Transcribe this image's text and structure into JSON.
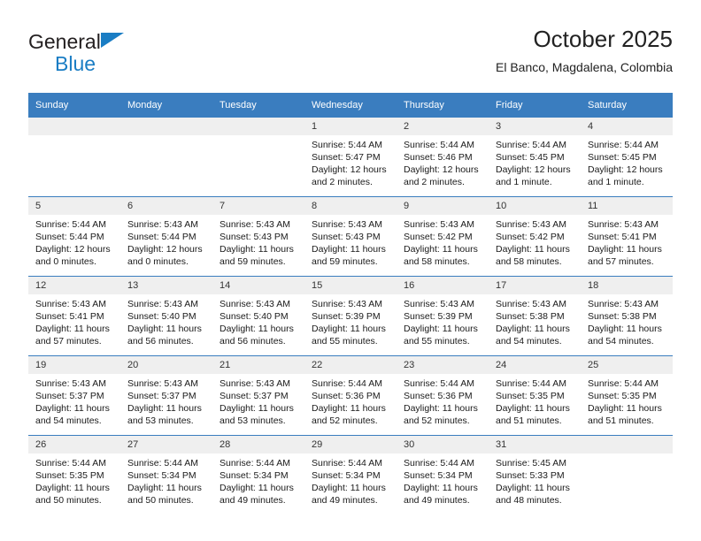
{
  "brand": {
    "name_part1": "General",
    "name_part2": "Blue",
    "triangle_color": "#1a7dc4"
  },
  "header": {
    "title": "October 2025",
    "subtitle": "El Banco, Magdalena, Colombia"
  },
  "theme": {
    "header_bg": "#3a7dbf",
    "daynum_bg": "#efefef",
    "text": "#1a1a1a"
  },
  "weekdays": [
    "Sunday",
    "Monday",
    "Tuesday",
    "Wednesday",
    "Thursday",
    "Friday",
    "Saturday"
  ],
  "weeks": [
    [
      {
        "day": "",
        "empty": true
      },
      {
        "day": "",
        "empty": true
      },
      {
        "day": "",
        "empty": true
      },
      {
        "day": "1",
        "sunrise": "Sunrise: 5:44 AM",
        "sunset": "Sunset: 5:47 PM",
        "daylight1": "Daylight: 12 hours",
        "daylight2": "and 2 minutes."
      },
      {
        "day": "2",
        "sunrise": "Sunrise: 5:44 AM",
        "sunset": "Sunset: 5:46 PM",
        "daylight1": "Daylight: 12 hours",
        "daylight2": "and 2 minutes."
      },
      {
        "day": "3",
        "sunrise": "Sunrise: 5:44 AM",
        "sunset": "Sunset: 5:45 PM",
        "daylight1": "Daylight: 12 hours",
        "daylight2": "and 1 minute."
      },
      {
        "day": "4",
        "sunrise": "Sunrise: 5:44 AM",
        "sunset": "Sunset: 5:45 PM",
        "daylight1": "Daylight: 12 hours",
        "daylight2": "and 1 minute."
      }
    ],
    [
      {
        "day": "5",
        "sunrise": "Sunrise: 5:44 AM",
        "sunset": "Sunset: 5:44 PM",
        "daylight1": "Daylight: 12 hours",
        "daylight2": "and 0 minutes."
      },
      {
        "day": "6",
        "sunrise": "Sunrise: 5:43 AM",
        "sunset": "Sunset: 5:44 PM",
        "daylight1": "Daylight: 12 hours",
        "daylight2": "and 0 minutes."
      },
      {
        "day": "7",
        "sunrise": "Sunrise: 5:43 AM",
        "sunset": "Sunset: 5:43 PM",
        "daylight1": "Daylight: 11 hours",
        "daylight2": "and 59 minutes."
      },
      {
        "day": "8",
        "sunrise": "Sunrise: 5:43 AM",
        "sunset": "Sunset: 5:43 PM",
        "daylight1": "Daylight: 11 hours",
        "daylight2": "and 59 minutes."
      },
      {
        "day": "9",
        "sunrise": "Sunrise: 5:43 AM",
        "sunset": "Sunset: 5:42 PM",
        "daylight1": "Daylight: 11 hours",
        "daylight2": "and 58 minutes."
      },
      {
        "day": "10",
        "sunrise": "Sunrise: 5:43 AM",
        "sunset": "Sunset: 5:42 PM",
        "daylight1": "Daylight: 11 hours",
        "daylight2": "and 58 minutes."
      },
      {
        "day": "11",
        "sunrise": "Sunrise: 5:43 AM",
        "sunset": "Sunset: 5:41 PM",
        "daylight1": "Daylight: 11 hours",
        "daylight2": "and 57 minutes."
      }
    ],
    [
      {
        "day": "12",
        "sunrise": "Sunrise: 5:43 AM",
        "sunset": "Sunset: 5:41 PM",
        "daylight1": "Daylight: 11 hours",
        "daylight2": "and 57 minutes."
      },
      {
        "day": "13",
        "sunrise": "Sunrise: 5:43 AM",
        "sunset": "Sunset: 5:40 PM",
        "daylight1": "Daylight: 11 hours",
        "daylight2": "and 56 minutes."
      },
      {
        "day": "14",
        "sunrise": "Sunrise: 5:43 AM",
        "sunset": "Sunset: 5:40 PM",
        "daylight1": "Daylight: 11 hours",
        "daylight2": "and 56 minutes."
      },
      {
        "day": "15",
        "sunrise": "Sunrise: 5:43 AM",
        "sunset": "Sunset: 5:39 PM",
        "daylight1": "Daylight: 11 hours",
        "daylight2": "and 55 minutes."
      },
      {
        "day": "16",
        "sunrise": "Sunrise: 5:43 AM",
        "sunset": "Sunset: 5:39 PM",
        "daylight1": "Daylight: 11 hours",
        "daylight2": "and 55 minutes."
      },
      {
        "day": "17",
        "sunrise": "Sunrise: 5:43 AM",
        "sunset": "Sunset: 5:38 PM",
        "daylight1": "Daylight: 11 hours",
        "daylight2": "and 54 minutes."
      },
      {
        "day": "18",
        "sunrise": "Sunrise: 5:43 AM",
        "sunset": "Sunset: 5:38 PM",
        "daylight1": "Daylight: 11 hours",
        "daylight2": "and 54 minutes."
      }
    ],
    [
      {
        "day": "19",
        "sunrise": "Sunrise: 5:43 AM",
        "sunset": "Sunset: 5:37 PM",
        "daylight1": "Daylight: 11 hours",
        "daylight2": "and 54 minutes."
      },
      {
        "day": "20",
        "sunrise": "Sunrise: 5:43 AM",
        "sunset": "Sunset: 5:37 PM",
        "daylight1": "Daylight: 11 hours",
        "daylight2": "and 53 minutes."
      },
      {
        "day": "21",
        "sunrise": "Sunrise: 5:43 AM",
        "sunset": "Sunset: 5:37 PM",
        "daylight1": "Daylight: 11 hours",
        "daylight2": "and 53 minutes."
      },
      {
        "day": "22",
        "sunrise": "Sunrise: 5:44 AM",
        "sunset": "Sunset: 5:36 PM",
        "daylight1": "Daylight: 11 hours",
        "daylight2": "and 52 minutes."
      },
      {
        "day": "23",
        "sunrise": "Sunrise: 5:44 AM",
        "sunset": "Sunset: 5:36 PM",
        "daylight1": "Daylight: 11 hours",
        "daylight2": "and 52 minutes."
      },
      {
        "day": "24",
        "sunrise": "Sunrise: 5:44 AM",
        "sunset": "Sunset: 5:35 PM",
        "daylight1": "Daylight: 11 hours",
        "daylight2": "and 51 minutes."
      },
      {
        "day": "25",
        "sunrise": "Sunrise: 5:44 AM",
        "sunset": "Sunset: 5:35 PM",
        "daylight1": "Daylight: 11 hours",
        "daylight2": "and 51 minutes."
      }
    ],
    [
      {
        "day": "26",
        "sunrise": "Sunrise: 5:44 AM",
        "sunset": "Sunset: 5:35 PM",
        "daylight1": "Daylight: 11 hours",
        "daylight2": "and 50 minutes."
      },
      {
        "day": "27",
        "sunrise": "Sunrise: 5:44 AM",
        "sunset": "Sunset: 5:34 PM",
        "daylight1": "Daylight: 11 hours",
        "daylight2": "and 50 minutes."
      },
      {
        "day": "28",
        "sunrise": "Sunrise: 5:44 AM",
        "sunset": "Sunset: 5:34 PM",
        "daylight1": "Daylight: 11 hours",
        "daylight2": "and 49 minutes."
      },
      {
        "day": "29",
        "sunrise": "Sunrise: 5:44 AM",
        "sunset": "Sunset: 5:34 PM",
        "daylight1": "Daylight: 11 hours",
        "daylight2": "and 49 minutes."
      },
      {
        "day": "30",
        "sunrise": "Sunrise: 5:44 AM",
        "sunset": "Sunset: 5:34 PM",
        "daylight1": "Daylight: 11 hours",
        "daylight2": "and 49 minutes."
      },
      {
        "day": "31",
        "sunrise": "Sunrise: 5:45 AM",
        "sunset": "Sunset: 5:33 PM",
        "daylight1": "Daylight: 11 hours",
        "daylight2": "and 48 minutes."
      },
      {
        "day": "",
        "empty": true
      }
    ]
  ]
}
